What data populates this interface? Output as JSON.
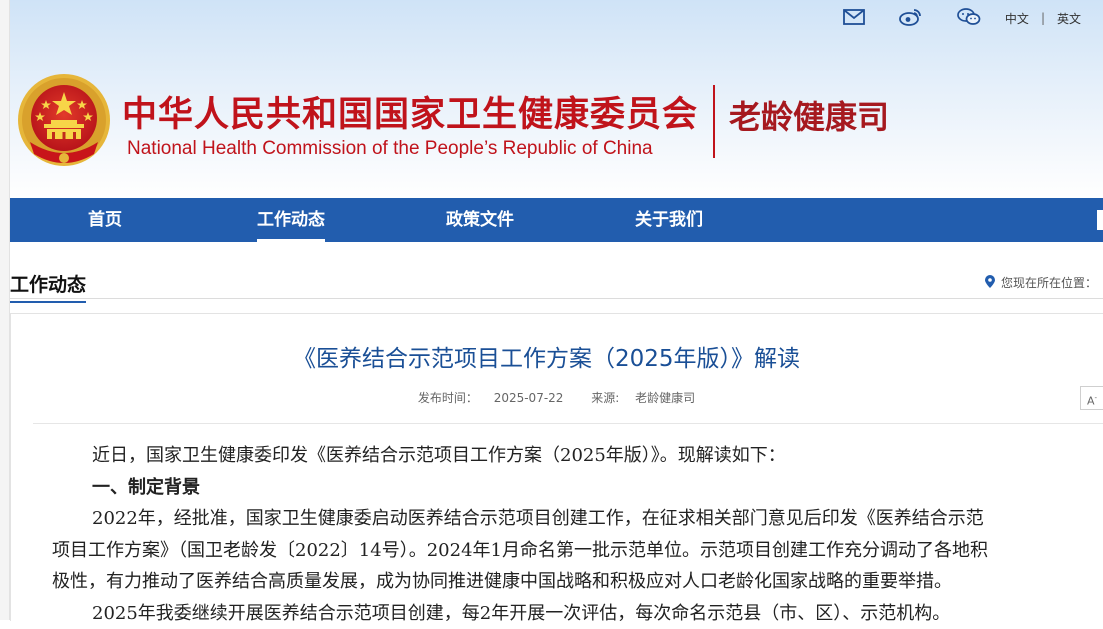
{
  "header": {
    "title_cn": "中华人民共和国国家卫生健康委员会",
    "title_en": "National Health Commission of the People’s  Republic of China",
    "department": "老龄健康司",
    "topbar": {
      "icons": [
        "mail-icon",
        "weibo-icon",
        "wechat-icon"
      ],
      "lang_cn": "中文",
      "separator": "|",
      "lang_en": "英文"
    }
  },
  "nav": {
    "items": [
      {
        "label": "首页",
        "active": false
      },
      {
        "label": "工作动态",
        "active": true
      },
      {
        "label": "政策文件",
        "active": false
      },
      {
        "label": "关于我们",
        "active": false
      }
    ]
  },
  "section": {
    "title": "工作动态",
    "location_label": "您现在所在位置："
  },
  "article": {
    "title": "《医养结合示范项目工作方案（2025年版）》解读",
    "published_label": "发布时间：",
    "published_date": "2025-07-22",
    "source_label": "来源:",
    "source": "老龄健康司",
    "font_button": "A",
    "paragraphs": [
      "近日，国家卫生健康委印发《医养结合示范项目工作方案（2025年版）》。现解读如下：",
      "一、制定背景",
      "2022年，经批准，国家卫生健康委启动医养结合示范项目创建工作，在征求相关部门意见后印发《医养结合示范",
      "项目工作方案》（国卫老龄发〔2022〕14号）。2024年1月命名第一批示范单位。示范项目创建工作充分调动了各地积",
      "极性，有力推动了医养结合高质量发展，成为协同推进健康中国战略和积极应对人口老龄化国家战略的重要举措。",
      "2025年我委继续开展医养结合示范项目创建，每2年开展一次评估，每次命名示范县（市、区）、示范机构。"
    ]
  },
  "colors": {
    "brand_red": "#c0131b",
    "nav_blue": "#225dae",
    "title_blue": "#1a4f96"
  }
}
